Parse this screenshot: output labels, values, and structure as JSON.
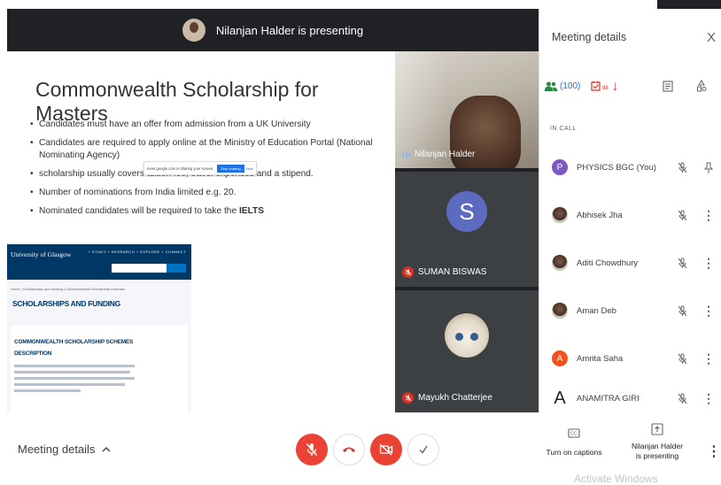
{
  "presenting": {
    "text": "Nilanjan Halder is presenting"
  },
  "slide": {
    "title": "Commonwealth Scholarship for Masters",
    "bullets": [
      "Candidates must have an offer from admission from a UK University",
      "Candidates are required to apply online at the Ministry of Education Portal (National Nominating Agency)",
      "scholarship usually covers tuition fee, travel expenses and a stipend.",
      "Number of nominations from India limited e.g. 20.",
      "Nominated candidates will be required to take the "
    ],
    "bullet_emphasis": "IELTS",
    "website": {
      "logo": "University of Glasgow",
      "nav": "+ STUDY   + RESEARCH   + EXPLORE   + CONNECT",
      "breadcrumb": "Home  |  Scholarships and funding  |  Commonwealth Scholarship schemes",
      "heading": "SCHOLARSHIPS AND FUNDING",
      "subheading_1": "COMMONWEALTH SCHOLARSHIP SCHEMES",
      "subheading_2": "DESCRIPTION",
      "share_notice": "meet.google.com is sharing your screen.",
      "stop_sharing": "Stop sharing",
      "hide": "Hide"
    }
  },
  "tiles": [
    {
      "name": "Nilanjan Halder",
      "speaking": true
    },
    {
      "name": "SUMAN BISWAS",
      "initial": "S",
      "avatar_color": "#5c6bc0",
      "muted": true
    },
    {
      "name": "Mayukh Chatterjee",
      "muted": true
    }
  ],
  "panel": {
    "title": "Meeting details",
    "close": "X",
    "people_count": "(100)",
    "tasks_count": "98",
    "section_label": "IN CALL",
    "participants": [
      {
        "name": "PHYSICS BGC (You)",
        "initial": "P",
        "color": "#7e57c2"
      },
      {
        "name": "Abhisek Jha"
      },
      {
        "name": "Aditi Chowdhury"
      },
      {
        "name": "Aman Deb"
      },
      {
        "name": "Amrita Saha",
        "initial": "A",
        "color": "#f4511e"
      },
      {
        "name": "ANAMITRA GIRI",
        "initial": "A"
      }
    ]
  },
  "bottom": {
    "meeting_details": "Meeting details",
    "captions": "Turn on captions",
    "present": "Nilanjan Halder is presenting",
    "watermark": "Activate Windows"
  },
  "colors": {
    "danger": "#ea4335",
    "accent": "#1a73e8",
    "dark": "#202124"
  }
}
